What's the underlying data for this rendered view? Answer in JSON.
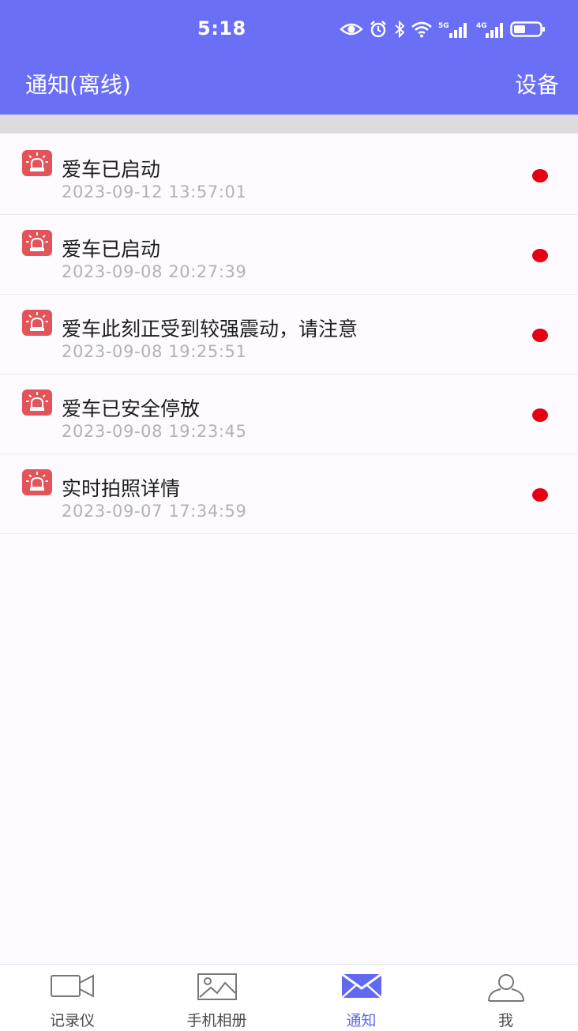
{
  "status_bar": {
    "time": "5:18",
    "icons": [
      "eye-icon",
      "alarm-icon",
      "bluetooth-icon",
      "wifi-icon",
      "signal-5g-icon",
      "signal-4g-icon",
      "battery-icon"
    ],
    "signal_5g_label": "5G",
    "signal_4g_label": "4G",
    "battery_level": 0.45
  },
  "header": {
    "title": "通知(离线)",
    "action_label": "设备",
    "background_color": "#6a6ff6"
  },
  "notifications": [
    {
      "title": "爱车已启动",
      "time": "2023-09-12 13:57:01",
      "unread": true
    },
    {
      "title": "爱车已启动",
      "time": "2023-09-08 20:27:39",
      "unread": true
    },
    {
      "title": "爱车此刻正受到较强震动，请注意",
      "time": "2023-09-08 19:25:51",
      "unread": true
    },
    {
      "title": "爱车已安全停放",
      "time": "2023-09-08 19:23:45",
      "unread": true
    },
    {
      "title": "实时拍照详情",
      "time": "2023-09-07 17:34:59",
      "unread": true
    }
  ],
  "notification_icon": "alarm-light-icon",
  "notification_icon_color": "#e2545a",
  "unread_dot_color": "#e60012",
  "tabbar": {
    "active_color": "#6168f2",
    "items": [
      {
        "label": "记录仪",
        "icon": "video-camera-icon",
        "active": false
      },
      {
        "label": "手机相册",
        "icon": "image-icon",
        "active": false
      },
      {
        "label": "通知",
        "icon": "envelope-icon",
        "active": true
      },
      {
        "label": "我",
        "icon": "user-icon",
        "active": false
      }
    ]
  }
}
